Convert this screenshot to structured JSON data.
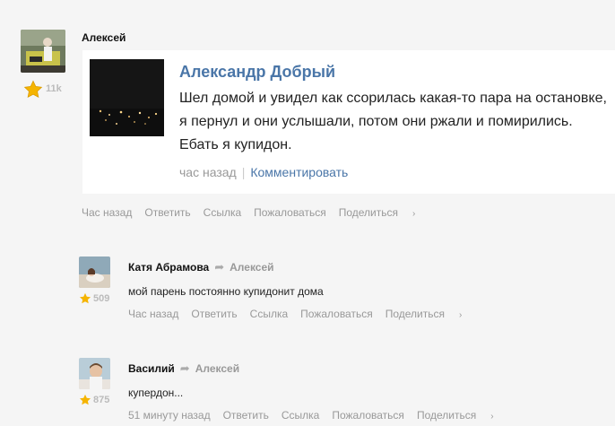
{
  "post": {
    "author": "Алексей",
    "rating": "11k",
    "quote": {
      "name": "Александр Добрый",
      "text": "Шел домой и увидел как ссорилась какая-то пара на остановке, я пернул и они услышали, потом они ржали и помирились. Ебать я купидон.",
      "time": "час назад",
      "separator": "|",
      "comment_label": "Комментировать"
    },
    "actions": {
      "time": "Час назад",
      "reply": "Ответить",
      "link": "Ссылка",
      "report": "Пожаловаться",
      "share": "Поделиться"
    }
  },
  "comments": [
    {
      "author": "Катя Абрамова",
      "reply_to": "Алексей",
      "rating": "509",
      "text": "мой парень постоянно купидонит дома",
      "actions": {
        "time": "Час назад",
        "reply": "Ответить",
        "link": "Ссылка",
        "report": "Пожаловаться",
        "share": "Поделиться"
      }
    },
    {
      "author": "Василий",
      "reply_to": "Алексей",
      "rating": "875",
      "text": "купердон...",
      "actions": {
        "time": "51 минуту назад",
        "reply": "Ответить",
        "link": "Ссылка",
        "report": "Пожаловаться",
        "share": "Поделиться"
      }
    }
  ],
  "icons": {
    "star": "star-icon",
    "arrow": "share-arrow-icon",
    "chevron": "chevron-right-icon"
  },
  "colors": {
    "link_blue": "#4a76a8",
    "star_gold": "#f5b400",
    "muted": "#999999"
  }
}
